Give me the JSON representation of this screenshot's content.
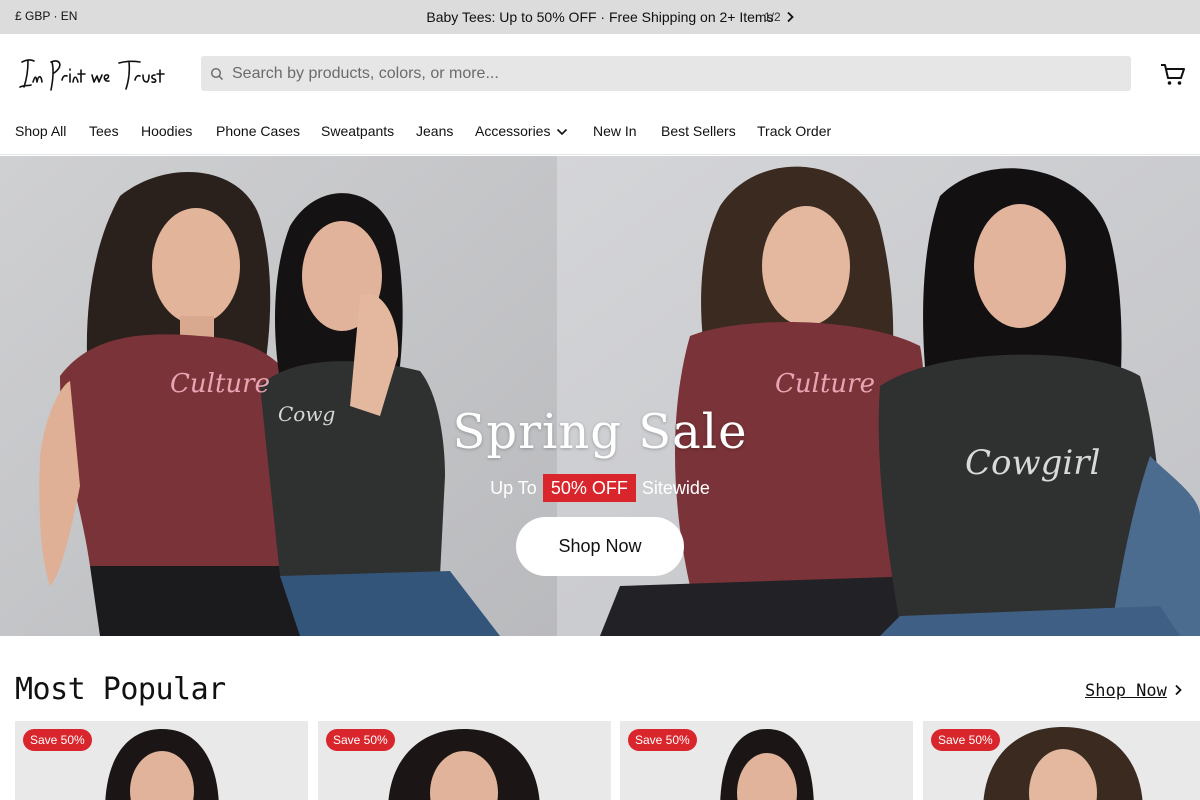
{
  "announcement": {
    "locale": "£ GBP · EN",
    "promo": "Baby Tees: Up to 50% OFF · Free Shipping on 2+ Items",
    "pager": "1/2"
  },
  "header": {
    "logo_text": "In Print we Trust",
    "search_placeholder": "Search by products, colors, or more..."
  },
  "nav": {
    "items": [
      "Shop All",
      "Tees",
      "Hoodies",
      "Phone Cases",
      "Sweatpants",
      "Jeans",
      "Accessories",
      "New In",
      "Best Sellers",
      "Track Order"
    ]
  },
  "hero": {
    "title": "Spring Sale",
    "sub_prefix": "Up To",
    "sub_badge": "50% OFF",
    "sub_suffix": "Sitewide",
    "button": "Shop Now",
    "shirt_text_left": "Culture",
    "shirt_text_left2": "Cowg",
    "shirt_text_right": "Culture",
    "shirt_text_right2": "Cowgirl"
  },
  "most_popular": {
    "title": "Most Popular",
    "link": "Shop Now",
    "cards": [
      {
        "badge": "Save 50%"
      },
      {
        "badge": "Save 50%"
      },
      {
        "badge": "Save 50%"
      },
      {
        "badge": "Save 50%"
      }
    ]
  },
  "colors": {
    "accent_red": "#d9262c",
    "announce_bg": "#dcdcdc",
    "search_bg": "#e6e6e6",
    "maroon_shirt": "#7a3338",
    "dark_shirt": "#2f3030"
  }
}
